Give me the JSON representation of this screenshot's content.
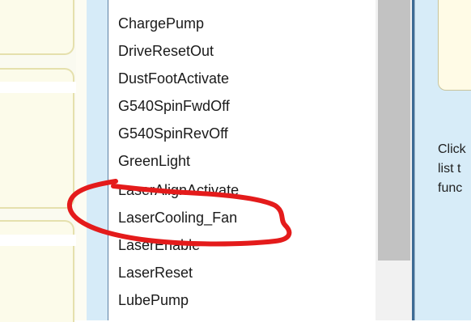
{
  "list": {
    "items": [
      "ChargePump",
      "DriveResetOut",
      "DustFootActivate",
      "G540SpinFwdOff",
      "G540SpinRevOff",
      "GreenLight",
      "LaserAlignActivate",
      "LaserCooling_Fan",
      "LaserEnable",
      "LaserReset",
      "LubePump"
    ]
  },
  "help": {
    "line1": "Click",
    "line2": "list t",
    "line3": "func"
  },
  "annotation": {
    "color": "#e41b1b",
    "highlighted_item": "LaserCooling_Fan"
  }
}
